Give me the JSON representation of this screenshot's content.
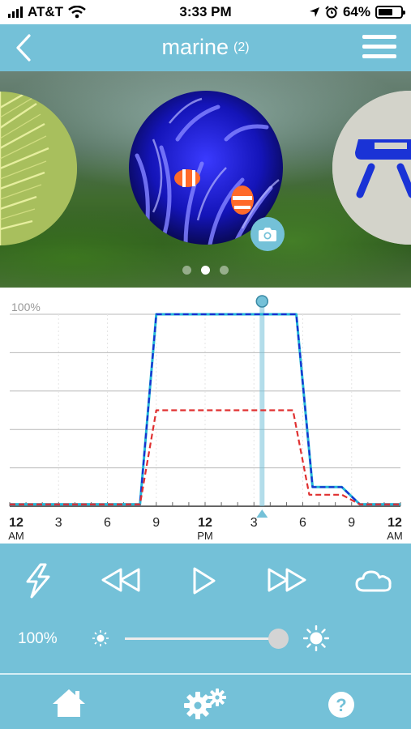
{
  "status_bar": {
    "carrier": "AT&T",
    "time": "3:33 PM",
    "battery": "64%"
  },
  "header": {
    "title": "marine",
    "count": "(2)"
  },
  "carousel": {
    "active_index": 1,
    "page_count": 3
  },
  "chart": {
    "y_max_label": "100%",
    "ticks": [
      {
        "main": "12",
        "sub": "AM",
        "bold": true
      },
      {
        "main": "3",
        "sub": "",
        "bold": false
      },
      {
        "main": "6",
        "sub": "",
        "bold": false
      },
      {
        "main": "9",
        "sub": "",
        "bold": false
      },
      {
        "main": "12",
        "sub": "PM",
        "bold": true
      },
      {
        "main": "3",
        "sub": "",
        "bold": false
      },
      {
        "main": "6",
        "sub": "",
        "bold": false
      },
      {
        "main": "9",
        "sub": "",
        "bold": false
      },
      {
        "main": "12",
        "sub": "AM",
        "bold": true
      }
    ]
  },
  "chart_data": {
    "type": "line",
    "xlabel": "",
    "ylabel": "",
    "x_unit": "hour",
    "xlim": [
      0,
      24
    ],
    "ylim": [
      0,
      100
    ],
    "current_hour": 15.5,
    "grid": true,
    "series": [
      {
        "color": "#22b8d8",
        "dash": false,
        "points": [
          [
            0,
            1
          ],
          [
            8,
            1
          ],
          [
            9,
            100
          ],
          [
            17.6,
            100
          ],
          [
            18.6,
            10
          ],
          [
            20.4,
            10
          ],
          [
            21.5,
            1
          ],
          [
            24,
            1
          ]
        ]
      },
      {
        "color": "#1a2fd0",
        "dash": true,
        "points": [
          [
            0,
            1
          ],
          [
            8,
            1
          ],
          [
            9,
            100
          ],
          [
            17.6,
            100
          ],
          [
            18.6,
            10
          ],
          [
            20.4,
            10
          ],
          [
            21.5,
            1
          ],
          [
            24,
            1
          ]
        ]
      },
      {
        "color": "#e03030",
        "dash": true,
        "points": [
          [
            0,
            1
          ],
          [
            8,
            1
          ],
          [
            9,
            50
          ],
          [
            17.4,
            50
          ],
          [
            18.4,
            6
          ],
          [
            20.4,
            6
          ],
          [
            21.5,
            1
          ],
          [
            24,
            1
          ]
        ]
      }
    ]
  },
  "controls": {
    "intensity": "100%",
    "intensity_value": 100,
    "icons": [
      "lightning-icon",
      "rewind-icon",
      "play-icon",
      "fast-forward-icon",
      "cloud-icon"
    ]
  },
  "tabs": [
    {
      "name": "home",
      "icon": "home-icon"
    },
    {
      "name": "settings",
      "icon": "gears-icon"
    },
    {
      "name": "help",
      "icon": "question-icon"
    }
  ],
  "colors": {
    "accent": "#74c1d8",
    "white_channel": "#22b8d8",
    "blue_channel": "#1a2fd0",
    "red_channel": "#e03030"
  }
}
